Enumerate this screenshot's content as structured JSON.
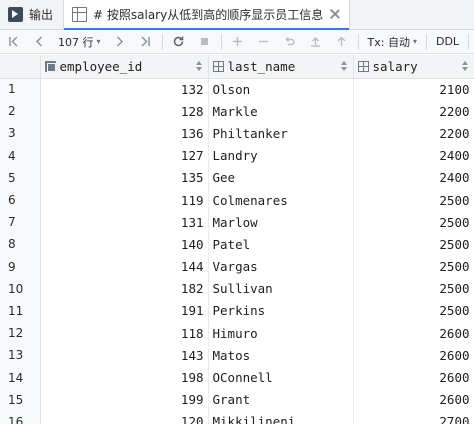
{
  "tabs": [
    {
      "label": "输出"
    },
    {
      "label": "# 按照salary从低到高的顺序显示员工信息"
    }
  ],
  "toolbar": {
    "row_count": "107 行",
    "tx_mode": "Tx: 自动",
    "ddl": "DDL"
  },
  "columns": [
    "employee_id",
    "last_name",
    "salary"
  ],
  "rows": [
    {
      "n": "1",
      "employee_id": "132",
      "last_name": "Olson",
      "salary": "2100"
    },
    {
      "n": "2",
      "employee_id": "128",
      "last_name": "Markle",
      "salary": "2200"
    },
    {
      "n": "3",
      "employee_id": "136",
      "last_name": "Philtanker",
      "salary": "2200"
    },
    {
      "n": "4",
      "employee_id": "127",
      "last_name": "Landry",
      "salary": "2400"
    },
    {
      "n": "5",
      "employee_id": "135",
      "last_name": "Gee",
      "salary": "2400"
    },
    {
      "n": "6",
      "employee_id": "119",
      "last_name": "Colmenares",
      "salary": "2500"
    },
    {
      "n": "7",
      "employee_id": "131",
      "last_name": "Marlow",
      "salary": "2500"
    },
    {
      "n": "8",
      "employee_id": "140",
      "last_name": "Patel",
      "salary": "2500"
    },
    {
      "n": "9",
      "employee_id": "144",
      "last_name": "Vargas",
      "salary": "2500"
    },
    {
      "n": "10",
      "employee_id": "182",
      "last_name": "Sullivan",
      "salary": "2500"
    },
    {
      "n": "11",
      "employee_id": "191",
      "last_name": "Perkins",
      "salary": "2500"
    },
    {
      "n": "12",
      "employee_id": "118",
      "last_name": "Himuro",
      "salary": "2600"
    },
    {
      "n": "13",
      "employee_id": "143",
      "last_name": "Matos",
      "salary": "2600"
    },
    {
      "n": "14",
      "employee_id": "198",
      "last_name": "OConnell",
      "salary": "2600"
    },
    {
      "n": "15",
      "employee_id": "199",
      "last_name": "Grant",
      "salary": "2600"
    },
    {
      "n": "16",
      "employee_id": "120",
      "last_name": "Mikkilineni",
      "salary": "2700"
    }
  ]
}
